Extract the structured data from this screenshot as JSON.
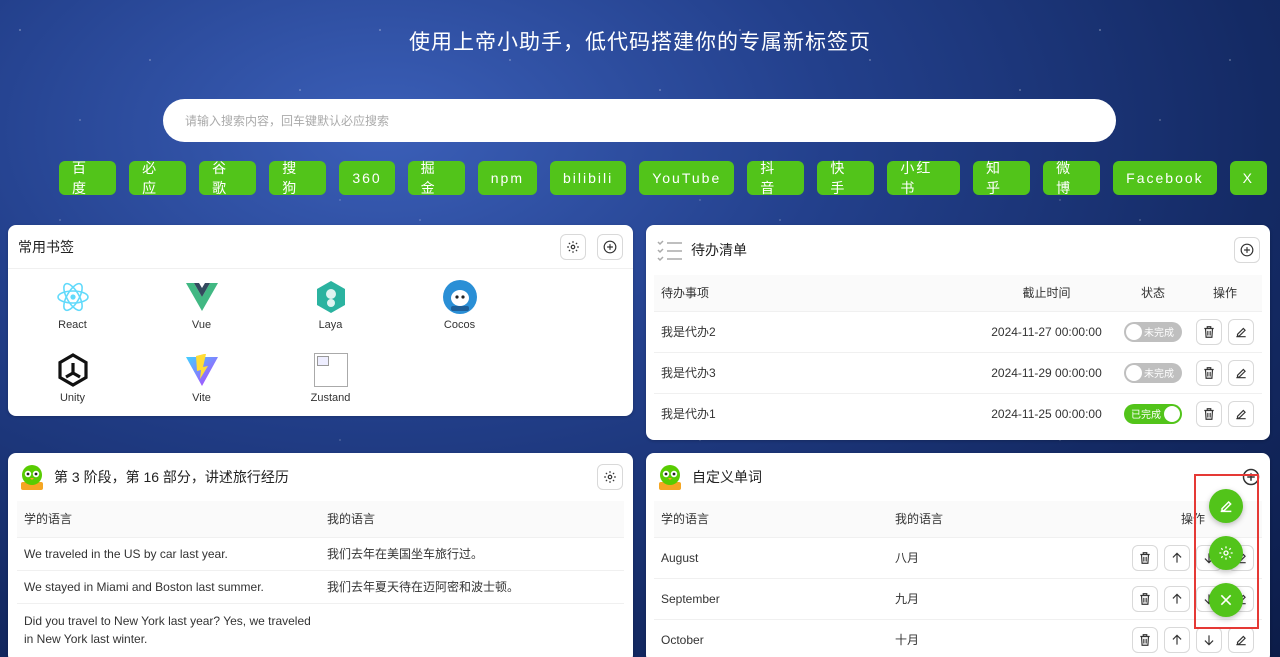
{
  "headline": "使用上帝小助手，低代码搭建你的专属新标签页",
  "search": {
    "placeholder": "请输入搜索内容，回车键默认必应搜索"
  },
  "engines": [
    "百度",
    "必应",
    "谷歌",
    "搜狗",
    "360",
    "掘金",
    "npm",
    "bilibili",
    "YouTube",
    "抖音",
    "快手",
    "小红书",
    "知乎",
    "微博",
    "Facebook",
    "X"
  ],
  "bookmarks": {
    "title": "常用书签",
    "items": [
      {
        "name": "React",
        "icon": "react-logo"
      },
      {
        "name": "Vue",
        "icon": "vue-logo"
      },
      {
        "name": "Laya",
        "icon": "laya-logo"
      },
      {
        "name": "Cocos",
        "icon": "cocos-logo"
      },
      {
        "name": "Unity",
        "icon": "unity-logo"
      },
      {
        "name": "Vite",
        "icon": "vite-logo"
      },
      {
        "name": "Zustand",
        "icon": "broken-image"
      }
    ]
  },
  "todo": {
    "title": "待办清单",
    "columns": [
      "待办事项",
      "截止时间",
      "状态",
      "操作"
    ],
    "rows": [
      {
        "item": "我是代办2",
        "deadline": "2024-11-27 00:00:00",
        "status": "未完成",
        "done": false
      },
      {
        "item": "我是代办3",
        "deadline": "2024-11-29 00:00:00",
        "status": "未完成",
        "done": false
      },
      {
        "item": "我是代办1",
        "deadline": "2024-11-25 00:00:00",
        "status": "已完成",
        "done": true
      }
    ]
  },
  "phrases": {
    "title": "第 3 阶段，第 16 部分，讲述旅行经历",
    "columns": [
      "学的语言",
      "我的语言"
    ],
    "rows": [
      {
        "learn": "We traveled in the US by car last year.",
        "mine": "我们去年在美国坐车旅行过。"
      },
      {
        "learn": "We stayed in Miami and Boston last summer.",
        "mine": "我们去年夏天待在迈阿密和波士顿。"
      },
      {
        "learn": "Did you travel to New York last year? Yes, we traveled in New York last winter.",
        "mine": ""
      }
    ]
  },
  "words": {
    "title": "自定义单词",
    "columns": [
      "学的语言",
      "我的语言",
      "操作"
    ],
    "rows": [
      {
        "learn": "August",
        "mine": "八月"
      },
      {
        "learn": "September",
        "mine": "九月"
      },
      {
        "learn": "October",
        "mine": "十月"
      }
    ]
  },
  "colors": {
    "accent": "#52c41a",
    "highlight": "#e53935"
  }
}
